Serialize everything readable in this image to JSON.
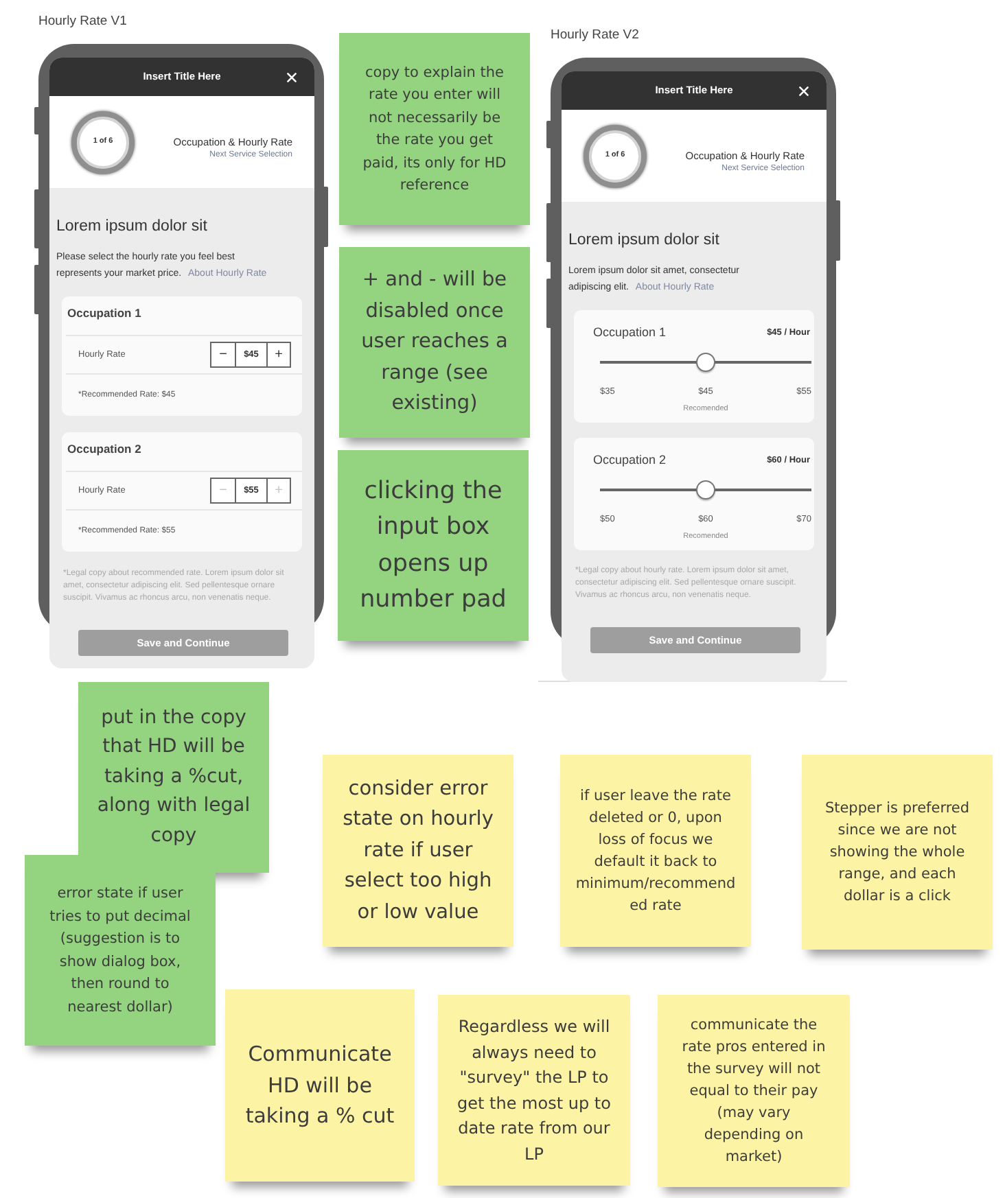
{
  "mockups": [
    {
      "label": "Hourly Rate V1",
      "title": "Insert Title Here",
      "step": "1 of 6",
      "step_title": "Occupation & Hourly Rate",
      "next_step": "Next Service Selection",
      "heading": "Lorem ipsum dolor sit",
      "intro": "Please select the hourly rate you feel best represents your market price.",
      "intro_link": "About Hourly Rate",
      "occupations": [
        {
          "kind": "stepper",
          "name": "Occupation 1",
          "field_label": "Hourly Rate",
          "minus": "−",
          "value": "$45",
          "plus": "+",
          "minus_disabled": false,
          "plus_disabled": false,
          "recommended": "*Recommended Rate: $45"
        },
        {
          "kind": "stepper",
          "name": "Occupation 2",
          "field_label": "Hourly Rate",
          "minus": "−",
          "value": "$55",
          "plus": "+",
          "minus_disabled": true,
          "plus_disabled": true,
          "recommended": "*Recommended Rate: $55"
        }
      ],
      "legal": "*Legal copy about recommended rate. Lorem ipsum dolor sit amet, consectetur adipiscing elit. Sed pellentesque ornare suscipit. Vivamus ac rhoncus arcu, non venenatis neque.",
      "button": "Save and Continue"
    },
    {
      "label": "Hourly Rate V2",
      "title": "Insert Title Here",
      "step": "1 of 6",
      "step_title": "Occupation & Hourly Rate",
      "next_step": "Next Service Selection",
      "heading": "Lorem ipsum dolor sit",
      "intro": "Lorem ipsum dolor sit amet, consectetur adipiscing elit.",
      "intro_link": "About Hourly Rate",
      "occupations": [
        {
          "kind": "slider",
          "name": "Occupation 1",
          "rate": "$45 / Hour",
          "level": 0.5,
          "ticks": [
            "$35",
            "$45",
            "$55"
          ],
          "tick_note": "Recomended"
        },
        {
          "kind": "slider",
          "name": "Occupation 2",
          "rate": "$60 / Hour",
          "level": 0.5,
          "ticks": [
            "$50",
            "$60",
            "$70"
          ],
          "tick_note": "Recomended"
        }
      ],
      "legal": "*Legal copy about hourly rate. Lorem ipsum dolor sit amet, consectetur adipiscing elit. Sed pellentesque ornare suscipit. Vivamus ac rhoncus arcu, non venenatis neque.",
      "button": "Save and Continue"
    }
  ],
  "notes": [
    {
      "text": "copy to explain the rate you enter will not necessarily be the rate you get paid, its only for HD reference",
      "color": "#94d480"
    },
    {
      "text": "+ and - will be disabled once user reaches a range (see existing)",
      "color": "#94d480"
    },
    {
      "text": "clicking the input box opens up number pad",
      "color": "#94d480"
    },
    {
      "text": "put in the copy that HD will be taking a %cut, along with legal copy",
      "color": "#94d480"
    },
    {
      "text": "consider error state on hourly rate if user select too high or low value",
      "color": "#fcf3a4"
    },
    {
      "text": "if user leave the rate deleted or 0, upon loss of focus we default it back to minimum/recommended rate",
      "color": "#fcf3a4"
    },
    {
      "text": "Stepper is preferred since we are not showing the whole range, and each dollar is a click",
      "color": "#fcf3a4"
    },
    {
      "text": "error state if user tries to put decimal (suggestion is to show dialog box, then round to nearest dollar)",
      "color": "#94d480"
    },
    {
      "text": "Communicate HD will be taking a % cut",
      "color": "#fcf3a4"
    },
    {
      "text": "Regardless we will always need to \"survey\" the LP to get the most up to date rate from our LP",
      "color": "#fcf3a4"
    },
    {
      "text": "communicate the rate pros entered in the survey will not equal to their pay (may vary depending on market)",
      "color": "#fcf3a4"
    }
  ]
}
